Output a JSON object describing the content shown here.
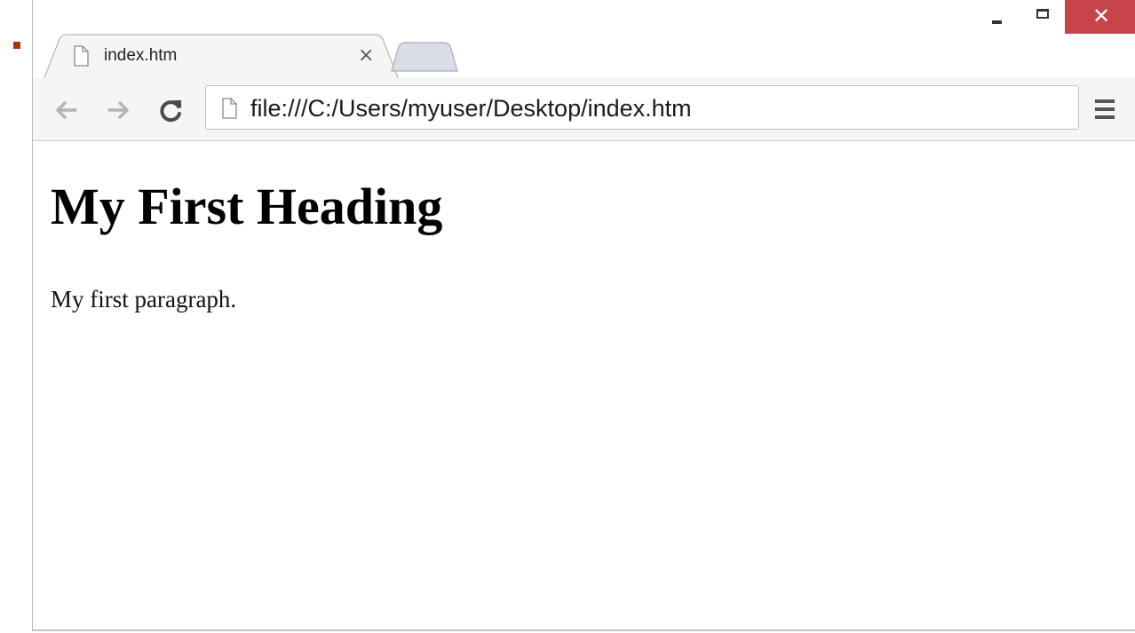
{
  "tab": {
    "title": "index.htm",
    "close_glyph": "×",
    "icon": "page-icon"
  },
  "window_controls": {
    "close_glyph": "✕",
    "close_color": "#c7444a"
  },
  "toolbar": {
    "url": "file:///C:/Users/myuser/Desktop/index.htm",
    "icons": [
      "back-arrow-icon",
      "forward-arrow-icon",
      "reload-icon",
      "page-icon",
      "menu-icon"
    ]
  },
  "page": {
    "heading": "My First Heading",
    "paragraph": "My first paragraph."
  },
  "colors": {
    "bullet": "#a83214",
    "toolbar_bg": "#f5f5f5"
  }
}
